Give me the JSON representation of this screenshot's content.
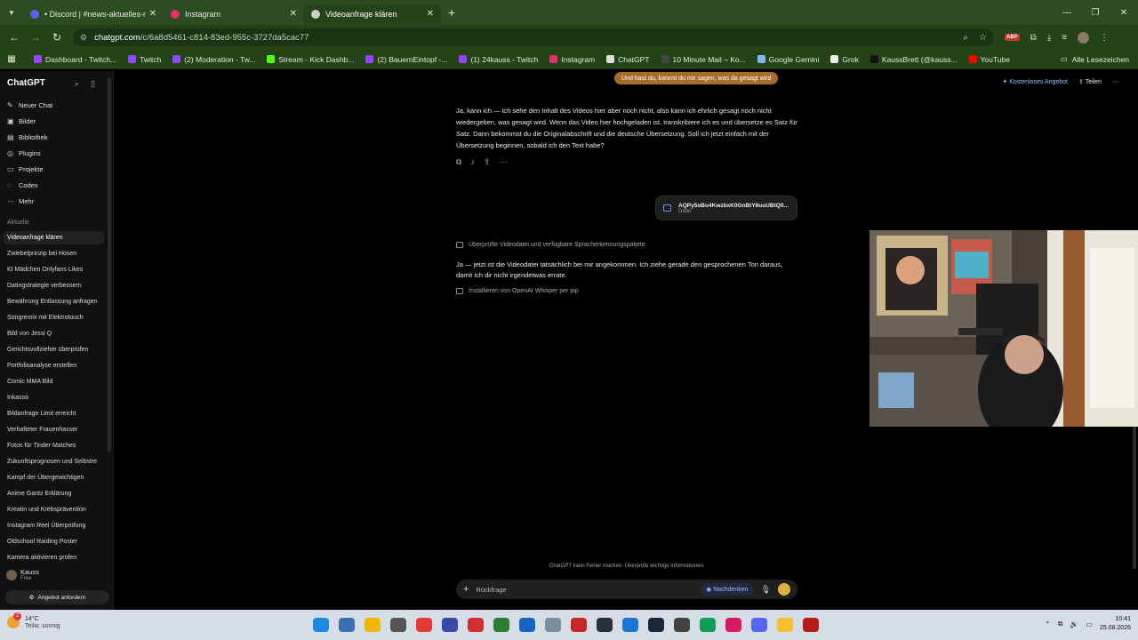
{
  "browser": {
    "tabs": [
      {
        "title": "• Discord | #news-aktuelles-no",
        "color": "#5865f2"
      },
      {
        "title": "Instagram",
        "color": "#e1306c"
      },
      {
        "title": "Videoanfrage klären",
        "color": "#cccccc"
      }
    ],
    "new_tab": "+",
    "url_domain": "chatgpt.com",
    "url_path": "/c/6a8d5461-c814-83ed-955c-3727da5cac77",
    "bookmarks": [
      {
        "label": "Dashboard - Twitch...",
        "color": "#9147ff"
      },
      {
        "label": "Twitch",
        "color": "#9147ff"
      },
      {
        "label": "(2) Moderation - Tw...",
        "color": "#9147ff"
      },
      {
        "label": "Stream - Kick Dashb...",
        "color": "#53fc18"
      },
      {
        "label": "(2) BauernEintopf -...",
        "color": "#9147ff"
      },
      {
        "label": "(1) 24kauss - Twitch",
        "color": "#9147ff"
      },
      {
        "label": "Instagram",
        "color": "#e1306c"
      },
      {
        "label": "ChatGPT",
        "color": "#dddddd"
      },
      {
        "label": "10 Minute Mail – Ko...",
        "color": "#444444"
      },
      {
        "label": "Google Gemini",
        "color": "#8ab4f8"
      },
      {
        "label": "Grok",
        "color": "#eeeeee"
      },
      {
        "label": "KaussBrett (@kauss...",
        "color": "#111111"
      },
      {
        "label": "YouTube",
        "color": "#ff0000"
      }
    ],
    "all_bookmarks": "Alle Lesezeichen"
  },
  "sidebar": {
    "brand": "ChatGPT",
    "nav": [
      {
        "label": "Neuer Chat",
        "icon": "edit-icon",
        "glyph": "✎"
      },
      {
        "label": "Bilder",
        "icon": "image-icon",
        "glyph": "▣"
      },
      {
        "label": "Bibliothek",
        "icon": "library-icon",
        "glyph": "▤"
      },
      {
        "label": "Plugins",
        "icon": "plugin-icon",
        "glyph": "◎"
      },
      {
        "label": "Projekte",
        "icon": "folder-icon",
        "glyph": "▭"
      },
      {
        "label": "Codex",
        "icon": "codex-icon",
        "glyph": "◌"
      },
      {
        "label": "Mehr",
        "icon": "more-icon",
        "glyph": "···"
      }
    ],
    "section": "Aktuelle",
    "chats": [
      "Videoanfrage klären",
      "Zwiebelprinzip bei Hosen",
      "KI Mädchen Onlyfans Likes",
      "Datingstrategie verbessern",
      "Bewährung Entlassung anfragen",
      "Songremix mit Elektrotouch",
      "Bild von Jessi Q",
      "Gerichtsvollzieher überprüfen",
      "Portfolioanalyse erstellen",
      "Comic MMA Bild",
      "Inkasso",
      "Bildanfrage Limit erreicht",
      "Verhafteter Frauenhasser",
      "Fotos für Tinder Matches",
      "Zukunftsprognosen und Selbstre",
      "Kampf der Übergewichtigen",
      "Anime Gantz Erklärung",
      "Kreatin und Krebsprävention",
      "Instagram Reel Überprüfung",
      "Oldschool Raiding Poster",
      "Kamera aktivieren prüfen"
    ],
    "user_name": "Kauss",
    "user_plan": "Free",
    "upgrade": "Angebot anfordern"
  },
  "main": {
    "user_bubble": "Und hast du, kannst du mir sagen, was da gesagt wird",
    "free_offer": "Kostenloses Angebot",
    "share": "Teilen",
    "assistant_msg": "Ja, kann ich — ich sehe den Inhalt des Videos hier aber noch nicht, also kann ich ehrlich gesagt noch nicht wiedergeben, was gesagt wird. Wenn das Video hier hochgeladen ist, transkribiere ich es und übersetze es Satz für Satz. Dann bekommst du die Originalabschrift und die deutsche Übersetzung. Soll ich jetzt einfach mit der Übersetzung beginnen, sobald ich den Text habe?",
    "file_name": "AQPy5oBu4KwzbxK0GnBtY8uuUBtQ0...",
    "file_type": "Datei",
    "step1": "Überprüfte Videodatei und verfügbare Spracherkennungspakete",
    "response": "Ja — jetzt ist die Videodatei tatsächlich bei mir angekommen. Ich ziehe gerade den gesprochenen Ton daraus, damit ich dir nicht irgendetwas errate.",
    "step2": "Installieren von OpenAI Whisper per pip",
    "disclaimer": "ChatGPT kann Fehler machen. Überprüfe wichtige Informationen.",
    "composer_placeholder": "Rückfrage",
    "think": "Nachdenken"
  },
  "taskbar": {
    "temp": "14°C",
    "weather": "Teilw. sonnig",
    "badge": "2",
    "time": "10:41",
    "date": "25.08.2026",
    "apps": [
      "#1e88e5",
      "#3a6fb0",
      "#f2b705",
      "#555555",
      "#e53935",
      "#3949ab",
      "#d32f2f",
      "#2e7d32",
      "#1565c0",
      "#78909c",
      "#c62828",
      "#263238",
      "#1976d2",
      "#1b2838",
      "#424242",
      "#0f9d58",
      "#d81b60",
      "#5865f2",
      "#fbc02d",
      "#b71c1c"
    ]
  }
}
